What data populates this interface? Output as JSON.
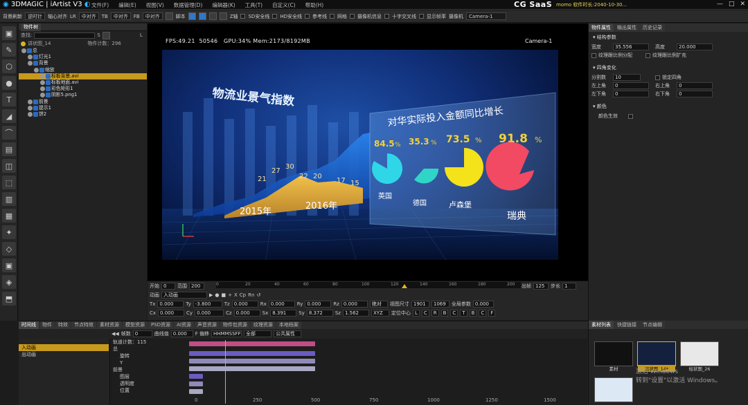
{
  "app": {
    "logo": "3DMAGIC | iArtist V3",
    "brand": "CG SaaS",
    "user": "momo 软件时长:",
    "user_time": "2040-10-30...",
    "window_buttons": [
      "—",
      "□",
      "✕"
    ]
  },
  "menu": [
    "文件(F)",
    "编辑(E)",
    "视图(V)",
    "数据管理(D)",
    "编辑器(K)",
    "工具(T)",
    "自定义(C)",
    "帮助(H)"
  ],
  "toolbar": {
    "items": [
      "背景刷新",
      "逆时针",
      "轴心对齐",
      "LR",
      "中对齐",
      "TB",
      "中对齐",
      "FB",
      "中对齐",
      "脚本",
      "Z轴",
      "SD安全线",
      "HD安全线",
      "参考线",
      "网格",
      "摄像机信息",
      "十字交叉线",
      "显示帧率",
      "摄像机",
      "Camera-1"
    ]
  },
  "left_tools": [
    "▣",
    "✎",
    "⬡",
    "●",
    "T",
    "◢",
    "⌒",
    "▤",
    "◫",
    "⬚",
    "▥",
    "▦",
    "✦",
    "◇",
    "▣",
    "◈",
    "⬒",
    "⬓",
    "◪",
    "⊞",
    "⊟"
  ],
  "object_panel": {
    "tab": "物件树",
    "search_label": "查找:",
    "filter_s": "S",
    "filter_l": "L",
    "scene_name": "讲状图_14",
    "count_label": "物件计数：296",
    "rows": [
      {
        "label": "总",
        "indent": 0,
        "hl": false
      },
      {
        "label": "灯光1",
        "indent": 1,
        "hl": false
      },
      {
        "label": "背景",
        "indent": 1,
        "hl": false
      },
      {
        "label": "缩放",
        "indent": 2,
        "hl": false
      },
      {
        "label": "标板背景.avi",
        "indent": 3,
        "hl": true
      },
      {
        "label": "标板地面.avi",
        "indent": 3,
        "hl": false
      },
      {
        "label": "彩色矩形1",
        "indent": 3,
        "hl": false
      },
      {
        "label": "阴影5.png1",
        "indent": 3,
        "hl": false
      },
      {
        "label": "前景",
        "indent": 1,
        "hl": false
      },
      {
        "label": "提示1",
        "indent": 1,
        "hl": false
      },
      {
        "label": "饼2",
        "indent": 1,
        "hl": false
      }
    ]
  },
  "viewport": {
    "fps": "FPS:49.21",
    "frame": "50546",
    "gpu": "GPU:34% Mem:2173/8192MB",
    "camera": "Camera-1",
    "scene_title": "物流业景气指数",
    "panel_title": "对华实际投入金额同比增长",
    "year1": "2015年",
    "year2": "2016年",
    "line_labels": [
      "21",
      "27",
      "30",
      "22",
      "20",
      "17",
      "15"
    ],
    "pies": [
      {
        "value": "84.5",
        "unit": "%",
        "label": "英国",
        "color": "#2fd6e8"
      },
      {
        "value": "35.3",
        "unit": "%",
        "label": "德国",
        "color": "#2fd6c8"
      },
      {
        "value": "73.5",
        "unit": "%",
        "label": "卢森堡",
        "color": "#f4e21b"
      },
      {
        "value": "91.8",
        "unit": "%",
        "label": "瑞典",
        "color": "#f24a62"
      }
    ]
  },
  "transport": {
    "start_label": "开始",
    "start": "0",
    "range_label": "范围",
    "range": "200",
    "ruler": [
      "0",
      "20",
      "40",
      "60",
      "80",
      "100",
      "120",
      "140",
      "160",
      "180",
      "200"
    ],
    "out_label": "出帧",
    "out": "125",
    "step_label": "步长",
    "step": "1",
    "anim_label": "动画",
    "anim_value": "入动画",
    "ctrl": [
      "X",
      "Cp",
      "Rn"
    ],
    "tx": "0.000",
    "ty": "-3.800",
    "tz": "0.000",
    "rx": "0.000",
    "ry": "0.000",
    "rz": "0.000",
    "abs": "绝对",
    "cx": "0.000",
    "cy": "0.000",
    "cz": "0.000",
    "sx": "8.391",
    "sy": "8.372",
    "sz": "1.562",
    "xyz": "XYZ",
    "viewport_size_label": "视图尺寸",
    "w": "1901",
    "h": "1069",
    "global_param_label": "全局参数",
    "global_param": "0.000",
    "pivot_label": "定位中心",
    "pivot": [
      "L",
      "C",
      "R",
      "B",
      "C",
      "T",
      "B",
      "C",
      "F"
    ]
  },
  "right_panel": {
    "tabs": [
      "物件属性",
      "输出属性",
      "历史记录"
    ],
    "section_structure": "结构参数",
    "width_label": "宽度",
    "width": "35.556",
    "height_label": "高度",
    "height": "20.000",
    "fix_ratio": "纹理跟比例分配",
    "tex_scale": "纹理跟比例扩充",
    "section_corner": "四角变化",
    "divs_label": "分割数",
    "divs": "10",
    "lock_label": "锁定四角",
    "tl_label": "左上角",
    "tl": "0",
    "tr_label": "右上角",
    "tr": "0",
    "bl_label": "左下角",
    "bl": "0",
    "br_label": "右下角",
    "br": "0",
    "section_color": "颜色",
    "color_effect": "颜色生效"
  },
  "bottom": {
    "tabs": [
      "时间线",
      "物件",
      "特效",
      "节点特效",
      "素材资源",
      "模型资源",
      "PSD资源",
      "AI资源",
      "声音资源",
      "物件包资源",
      "纹理资源",
      "本地档案"
    ],
    "left_rows": [
      {
        "label": "入动画",
        "hl": true
      },
      {
        "label": "出动画",
        "hl": false
      }
    ],
    "toolbar_items": [
      "帧数",
      "0",
      "曲线值",
      "0.000",
      "F 偏移",
      "HHMMSSFF",
      "全部",
      "公共属性"
    ],
    "track_count": "轨道计数：115",
    "tracks": [
      "总",
      "旋转",
      "Y",
      "前景",
      "图层",
      "透明度",
      "位置"
    ],
    "ticks": [
      "0",
      "250",
      "500",
      "750",
      "1000",
      "1250",
      "1500"
    ]
  },
  "materials": {
    "tabs": [
      "素材列表",
      "快捷链接",
      "节点编辑"
    ],
    "items": [
      "素材",
      "运状图_14*",
      "柱状图_26"
    ],
    "watermark1": "激活 Windows",
    "watermark2": "转到\"设置\"以激活 Windows。"
  }
}
